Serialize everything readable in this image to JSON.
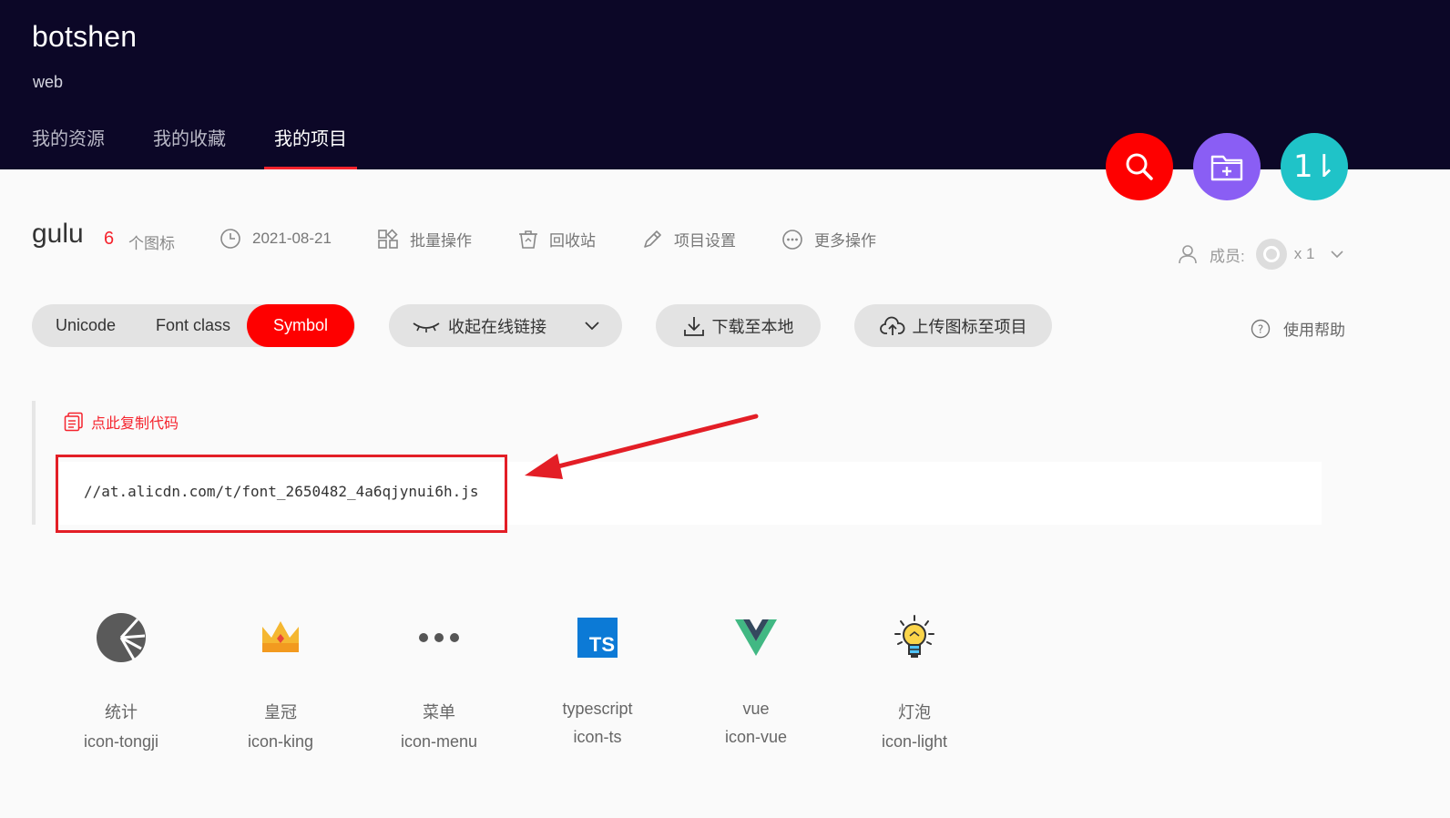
{
  "header": {
    "brand": "botshen",
    "subtitle": "web",
    "nav": [
      {
        "label": "我的资源"
      },
      {
        "label": "我的收藏"
      },
      {
        "label": "我的项目",
        "active": true
      }
    ],
    "fab_sort_glyph": "1⇂"
  },
  "project": {
    "name": "gulu",
    "icon_count": "6",
    "icon_count_label": "个图标",
    "date": "2021-08-21",
    "batch_ops": "批量操作",
    "recycle": "回收站",
    "settings": "项目设置",
    "more_ops": "更多操作",
    "members_label": "成员:",
    "members_count": "x 1"
  },
  "toolbar": {
    "tabs": [
      "Unicode",
      "Font class",
      "Symbol"
    ],
    "active_tab": "Symbol",
    "collapse_link": "收起在线链接",
    "download": "下载至本地",
    "upload": "上传图标至项目",
    "help": "使用帮助"
  },
  "code": {
    "copy_label": "点此复制代码",
    "url": "//at.alicdn.com/t/font_2650482_4a6qjynui6h.js"
  },
  "icons": [
    {
      "name": "统计",
      "code": "icon-tongji",
      "icon": "pie-chart-icon"
    },
    {
      "name": "皇冠",
      "code": "icon-king",
      "icon": "crown-icon"
    },
    {
      "name": "菜单",
      "code": "icon-menu",
      "icon": "dots-menu-icon"
    },
    {
      "name": "typescript",
      "code": "icon-ts",
      "icon": "typescript-icon",
      "badge": "TS"
    },
    {
      "name": "vue",
      "code": "icon-vue",
      "icon": "vue-icon"
    },
    {
      "name": "灯泡",
      "code": "icon-light",
      "icon": "lightbulb-icon"
    }
  ],
  "colors": {
    "header_bg": "#0c0727",
    "accent_red": "#fe0000",
    "purple": "#8a5ef4",
    "teal": "#1fc3c8"
  }
}
